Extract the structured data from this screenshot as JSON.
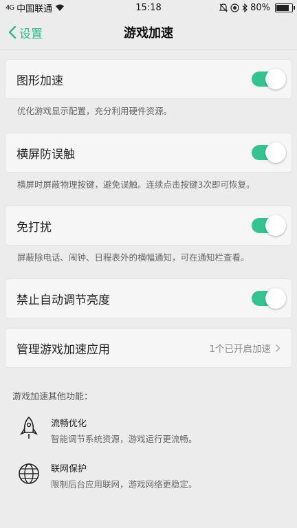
{
  "status": {
    "signal": "4G",
    "carrier": "中国联通",
    "time": "15:18",
    "battery": "80%",
    "battery_level": 0.8
  },
  "nav": {
    "back_label": "设置",
    "title": "游戏加速"
  },
  "settings": [
    {
      "label": "图形加速",
      "enabled": true,
      "desc": "优化游戏显示配置，充分利用硬件资源。"
    },
    {
      "label": "横屏防误触",
      "enabled": true,
      "desc": "横屏时屏蔽物理按键，避免误触。连续点击按键3次即可恢复。"
    },
    {
      "label": "免打扰",
      "enabled": true,
      "desc": "屏蔽除电话、闹钟、日程表外的横幅通知，可在通知栏查看。"
    },
    {
      "label": "禁止自动调节亮度",
      "enabled": true
    }
  ],
  "manage": {
    "label": "管理游戏加速应用",
    "value": "1个已开启加速"
  },
  "other": {
    "title": "游戏加速其他功能：",
    "features": [
      {
        "icon": "rocket-icon",
        "name": "流畅优化",
        "desc": "智能调节系统资源，游戏运行更流畅。"
      },
      {
        "icon": "globe-icon",
        "name": "联网保护",
        "desc": "限制后台应用联网，游戏网络更稳定。"
      }
    ]
  },
  "colors": {
    "accent": "#2bb88c",
    "toggle_on": "#33c492"
  }
}
